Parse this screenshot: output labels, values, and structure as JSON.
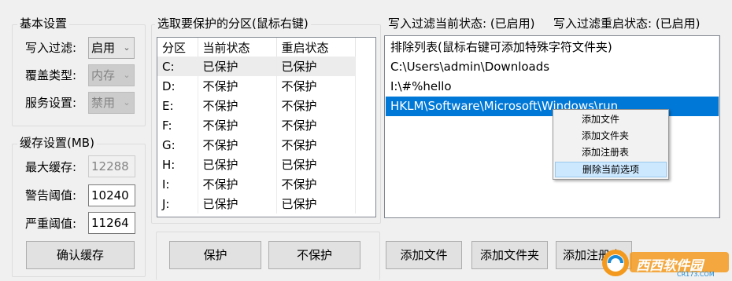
{
  "basic_settings": {
    "title": "基本设置",
    "write_filter_label": "写入过滤:",
    "write_filter_value": "启用",
    "overlay_type_label": "覆盖类型:",
    "overlay_type_value": "内存",
    "service_label": "服务设置:",
    "service_value": "禁用"
  },
  "cache_settings": {
    "title": "缓存设置(MB)",
    "max_label": "最大缓存:",
    "max_value": "12288",
    "warn_label": "警告阈值:",
    "warn_value": "10240",
    "severe_label": "严重阈值:",
    "severe_value": "11264",
    "confirm_button": "确认缓存"
  },
  "partitions": {
    "title": "选取要保护的分区(鼠标右键)",
    "columns": [
      "分区",
      "当前状态",
      "重启状态"
    ],
    "rows": [
      [
        "C:",
        "已保护",
        "已保护"
      ],
      [
        "D:",
        "不保护",
        "不保护"
      ],
      [
        "E:",
        "不保护",
        "不保护"
      ],
      [
        "F:",
        "不保护",
        "不保护"
      ],
      [
        "G:",
        "不保护",
        "不保护"
      ],
      [
        "H:",
        "已保护",
        "已保护"
      ],
      [
        "I:",
        "不保护",
        "不保护"
      ],
      [
        "J:",
        "已保护",
        "已保护"
      ]
    ],
    "protect_button": "保护",
    "unprotect_button": "不保护"
  },
  "filter_status": {
    "current_label": "写入过滤当前状态: (已启用)",
    "restart_label": "写入过滤重启状态: (已启用)"
  },
  "exclusion_list": {
    "items": [
      "排除列表(鼠标右键可添加特殊字符文件夹)",
      "C:\\Users\\admin\\Downloads",
      "I:\\#%hello",
      "HKLM\\Software\\Microsoft\\Windows\\run"
    ],
    "selected_index": 3
  },
  "context_menu": {
    "items": [
      "添加文件",
      "添加文件夹",
      "添加注册表",
      "删除当前选项"
    ],
    "highlighted_index": 3
  },
  "bottom_buttons": {
    "add_file": "添加文件",
    "add_folder": "添加文件夹",
    "add_registry": "添加注册表"
  },
  "watermark": {
    "text": "西西软件园",
    "subtext": "CR173.COM",
    "colors": {
      "orange": "#f39a1e",
      "blue": "#1a8ad6"
    }
  },
  "colors": {
    "window_bg": "#f0f0f0",
    "selection": "#0078d7",
    "menu_hot": "#cce8ff"
  }
}
